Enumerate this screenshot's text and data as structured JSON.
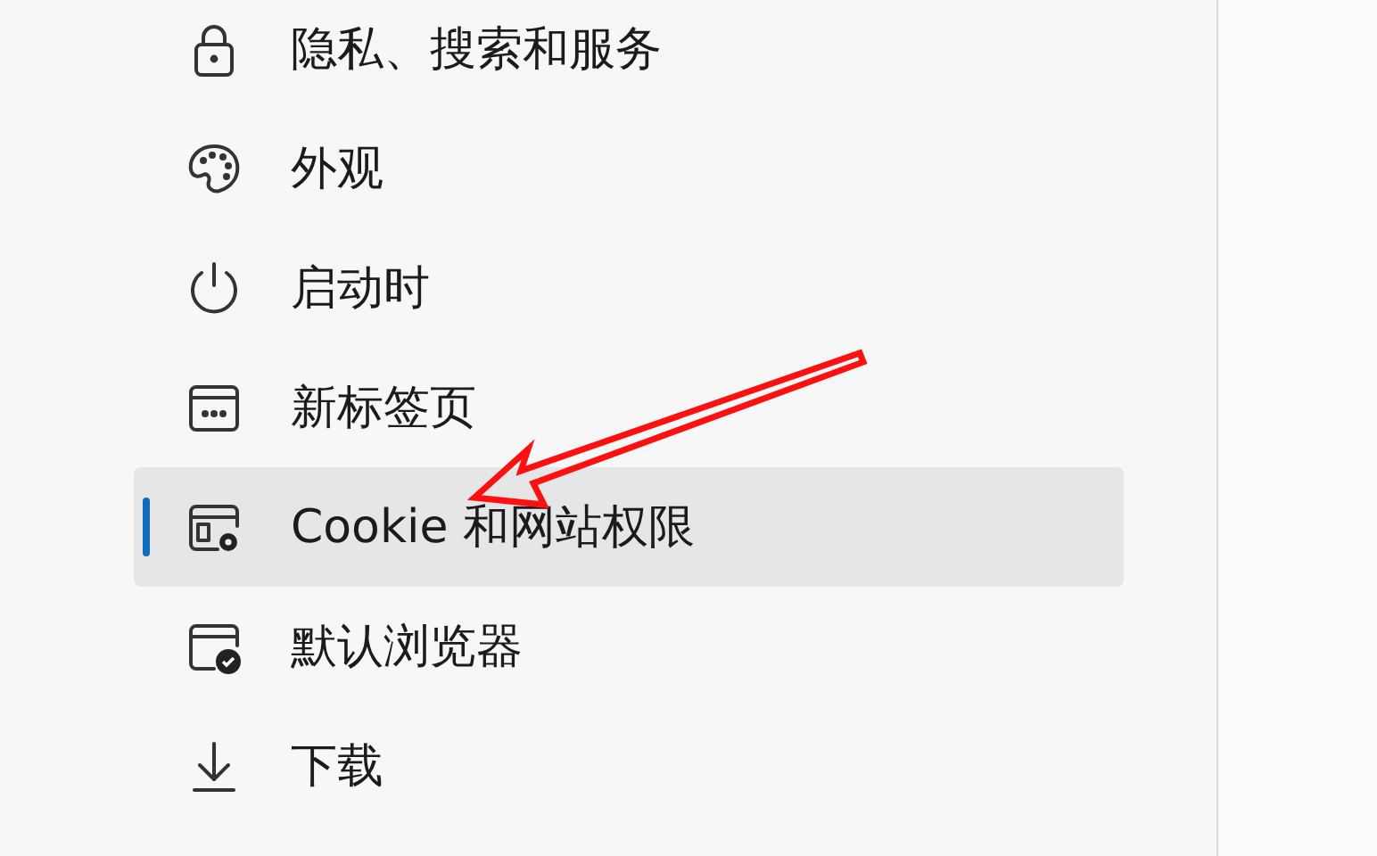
{
  "sidebar": {
    "items": [
      {
        "label": "隐私、搜索和服务",
        "selected": false
      },
      {
        "label": "外观",
        "selected": false
      },
      {
        "label": "启动时",
        "selected": false
      },
      {
        "label": "新标签页",
        "selected": false
      },
      {
        "label": "Cookie 和网站权限",
        "selected": true
      },
      {
        "label": "默认浏览器",
        "selected": false
      },
      {
        "label": "下载",
        "selected": false
      }
    ]
  }
}
